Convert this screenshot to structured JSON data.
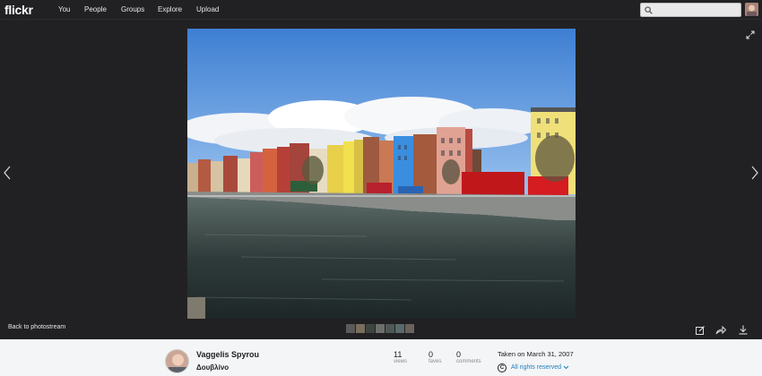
{
  "header": {
    "logo": "flickr",
    "nav": [
      "You",
      "People",
      "Groups",
      "Explore",
      "Upload"
    ],
    "search_placeholder": ""
  },
  "viewer": {
    "back_label": "Back to photostream",
    "icons": [
      "expand-icon",
      "prev-chevron-icon",
      "next-chevron-icon",
      "edit-icon",
      "share-icon",
      "download-icon"
    ]
  },
  "info": {
    "owner_name": "Vaggelis Spyrou",
    "photo_title": "Δουβλίνο",
    "views_count": "11",
    "views_label": "views",
    "faves_count": "0",
    "faves_label": "faves",
    "comments_count": "0",
    "comments_label": "comments",
    "taken": "Taken on March 31, 2007",
    "license_symbol": "C",
    "license": "All rights reserved"
  },
  "colors": {
    "background": "#212124",
    "accent_link": "#1c7ec2",
    "infobar": "#f3f5f6"
  }
}
